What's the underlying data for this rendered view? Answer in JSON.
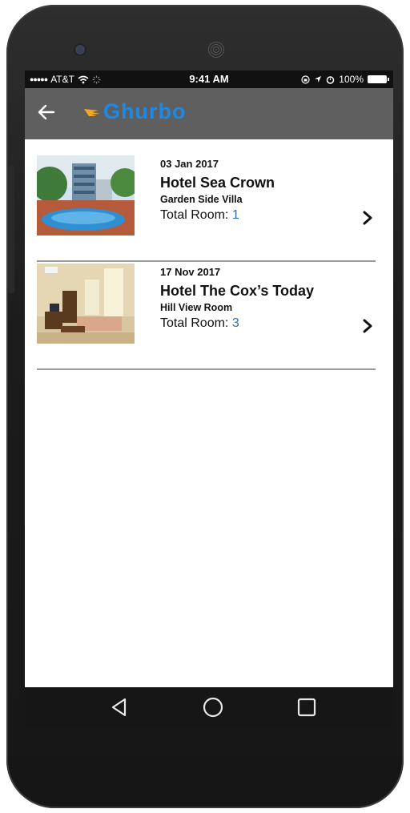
{
  "status_bar": {
    "carrier": "AT&T",
    "time": "9:41 AM",
    "battery": "100%"
  },
  "app_bar": {
    "logo_text": "Ghurbo"
  },
  "bookings": [
    {
      "date": "03 Jan 2017",
      "hotel": "Hotel Sea Crown",
      "room_type": "Garden Side Villa",
      "total_room_label": "Total Room:",
      "total_room_value": "1"
    },
    {
      "date": "17 Nov 2017",
      "hotel": "Hotel The Cox’s Today",
      "room_type": "Hill View Room",
      "total_room_label": "Total Room:",
      "total_room_value": "3"
    }
  ],
  "colors": {
    "app_bar": "#5f5f5f",
    "logo": "#1e88e5",
    "logo_wing": "#f5a623",
    "room_count": "#2a6fb0",
    "divider": "#9a9a9a"
  },
  "icons": {
    "back": "arrow-left-icon",
    "chevron": "chevron-right-icon",
    "nav_back": "triangle-back-icon",
    "nav_home": "circle-home-icon",
    "nav_recents": "square-recents-icon"
  }
}
